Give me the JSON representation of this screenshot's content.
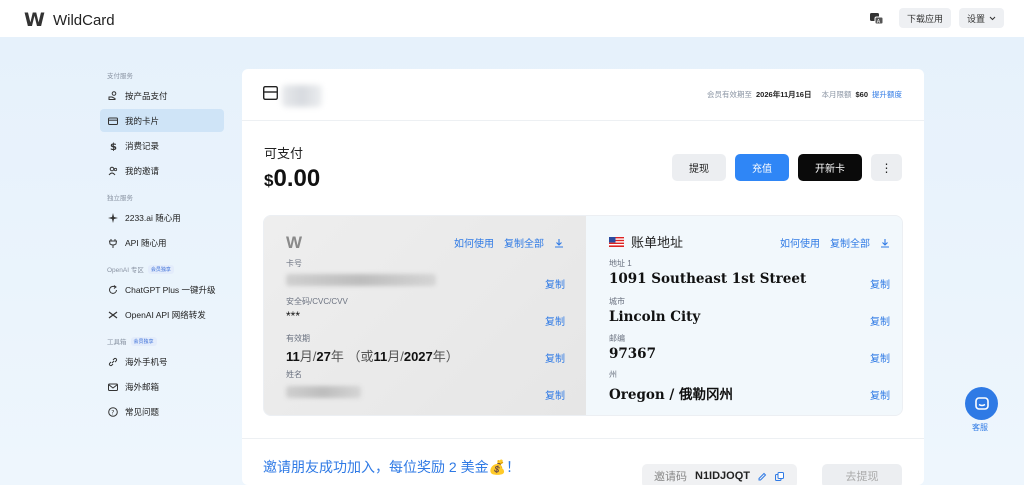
{
  "app": {
    "logo_mark": "W",
    "name": "WildCard"
  },
  "topbar": {
    "download": "下载应用",
    "settings": "设置"
  },
  "sidebar": {
    "sections": [
      {
        "title": "支付服务",
        "items": [
          {
            "label": "按产品支付",
            "icon": "hand-coin-icon"
          },
          {
            "label": "我的卡片",
            "icon": "card-icon",
            "active": true
          },
          {
            "label": "消费记录",
            "icon": "dollar-icon"
          },
          {
            "label": "我的邀请",
            "icon": "users-icon"
          }
        ]
      },
      {
        "title": "独立服务",
        "items": [
          {
            "label": "2233.ai 随心用",
            "icon": "sparkle-icon"
          },
          {
            "label": "API 随心用",
            "icon": "plug-icon"
          }
        ]
      },
      {
        "title": "OpenAI 专区",
        "badge": "会员独享",
        "items": [
          {
            "label": "ChatGPT Plus 一键升级",
            "icon": "refresh-icon"
          },
          {
            "label": "OpenAI API 网络转发",
            "icon": "shuffle-icon"
          }
        ]
      },
      {
        "title": "工具箱",
        "badge": "会员独享",
        "items": [
          {
            "label": "海外手机号",
            "icon": "link-icon"
          },
          {
            "label": "海外邮箱",
            "icon": "mail-icon"
          },
          {
            "label": "常见问题",
            "icon": "help-icon"
          }
        ]
      }
    ]
  },
  "header": {
    "member_expiry_label": "会员有效期至",
    "member_expiry": "2026年11月16日",
    "monthly_limit_label": "本月限额",
    "monthly_limit": "$60",
    "raise_limit": "提升额度"
  },
  "balance": {
    "label": "可支付",
    "currency": "$",
    "amount": "0.00"
  },
  "actions": {
    "withdraw": "提现",
    "recharge": "充值",
    "new_card": "开新卡",
    "more": "⋮"
  },
  "card": {
    "logo": "W",
    "how_to_use": "如何使用",
    "copy_all": "复制全部",
    "number_label": "卡号",
    "cvc_label": "安全码/CVC/CVV",
    "cvc": "***",
    "expiry_label": "有效期",
    "expiry_month": "11",
    "expiry_year": "27",
    "expiry_full_year": "2027",
    "name_label": "姓名",
    "copy": "复制"
  },
  "billing": {
    "title": "账单地址",
    "how_to_use": "如何使用",
    "copy_all": "复制全部",
    "fields": [
      {
        "label": "地址 1",
        "value": "1091 Southeast 1st Street"
      },
      {
        "label": "城市",
        "value": "Lincoln City"
      },
      {
        "label": "邮编",
        "value": "97367"
      },
      {
        "label": "州",
        "value": "Oregon / 俄勒冈州"
      }
    ],
    "copy": "复制"
  },
  "invite": {
    "text": "邀请朋友成功加入，每位奖励 2 美金💰！",
    "code_label": "邀请码",
    "code": "N1IDJOQT",
    "withdraw": "去提现"
  },
  "support": {
    "label": "客服"
  },
  "colors": {
    "accent": "#2f86f6",
    "link": "#2f7ae5"
  }
}
